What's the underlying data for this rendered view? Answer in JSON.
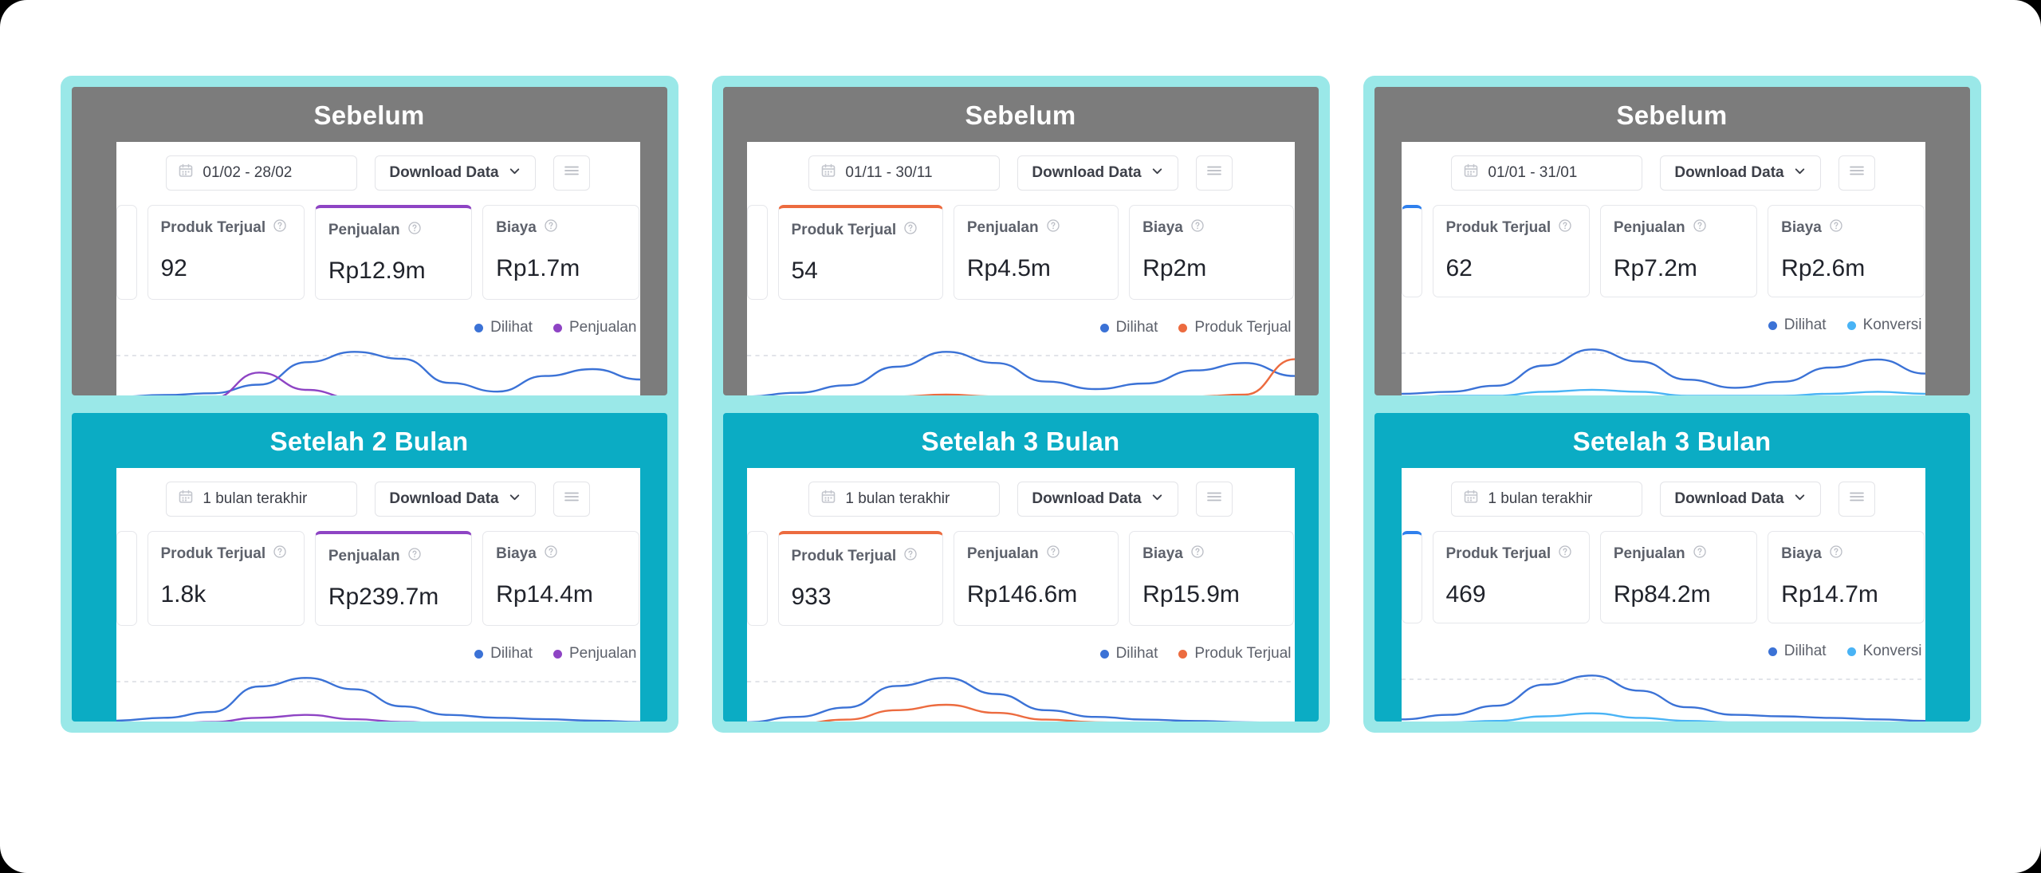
{
  "groups": [
    {
      "before": {
        "title": "Sebelum",
        "date_range": "01/02 - 28/02",
        "download_label": "Download Data",
        "metrics": [
          {
            "label": "Produk Terjual",
            "value": "92",
            "accent": "none"
          },
          {
            "label": "Penjualan",
            "value": "Rp12.9m",
            "accent": "#8e44c4"
          },
          {
            "label": "Biaya",
            "value": "Rp1.7m",
            "accent": "none"
          }
        ],
        "legend": [
          {
            "label": "Dilihat",
            "color": "#3b72d6"
          },
          {
            "label": "Penjualan",
            "color": "#8e44c4"
          }
        ]
      },
      "after": {
        "title": "Setelah 2 Bulan",
        "date_range": "1 bulan terakhir",
        "download_label": "Download Data",
        "metrics": [
          {
            "label": "Produk Terjual",
            "value": "1.8k",
            "accent": "none"
          },
          {
            "label": "Penjualan",
            "value": "Rp239.7m",
            "accent": "#8e44c4"
          },
          {
            "label": "Biaya",
            "value": "Rp14.4m",
            "accent": "none"
          }
        ],
        "legend": [
          {
            "label": "Dilihat",
            "color": "#3b72d6"
          },
          {
            "label": "Penjualan",
            "color": "#8e44c4"
          }
        ]
      }
    },
    {
      "before": {
        "title": "Sebelum",
        "date_range": "01/11 - 30/11",
        "download_label": "Download Data",
        "metrics": [
          {
            "label": "Produk Terjual",
            "value": "54",
            "accent": "#ec6b3f"
          },
          {
            "label": "Penjualan",
            "value": "Rp4.5m",
            "accent": "none"
          },
          {
            "label": "Biaya",
            "value": "Rp2m",
            "accent": "none"
          }
        ],
        "legend": [
          {
            "label": "Dilihat",
            "color": "#3b72d6"
          },
          {
            "label": "Produk Terjual",
            "color": "#ec6b3f"
          }
        ]
      },
      "after": {
        "title": "Setelah 3 Bulan",
        "date_range": "1 bulan terakhir",
        "download_label": "Download Data",
        "metrics": [
          {
            "label": "Produk Terjual",
            "value": "933",
            "accent": "#ec6b3f"
          },
          {
            "label": "Penjualan",
            "value": "Rp146.6m",
            "accent": "none"
          },
          {
            "label": "Biaya",
            "value": "Rp15.9m",
            "accent": "none"
          }
        ],
        "legend": [
          {
            "label": "Dilihat",
            "color": "#3b72d6"
          },
          {
            "label": "Produk Terjual",
            "color": "#ec6b3f"
          }
        ]
      }
    },
    {
      "before": {
        "title": "Sebelum",
        "date_range": "01/01 - 31/01",
        "download_label": "Download Data",
        "metrics": [
          {
            "label": "Produk Terjual",
            "value": "62",
            "accent": "none"
          },
          {
            "label": "Penjualan",
            "value": "Rp7.2m",
            "accent": "none"
          },
          {
            "label": "Biaya",
            "value": "Rp2.6m",
            "accent": "none"
          }
        ],
        "sliver_accent": "#2f80ed",
        "legend": [
          {
            "label": "Dilihat",
            "color": "#3b72d6"
          },
          {
            "label": "Konversi",
            "color": "#49b3f5"
          }
        ]
      },
      "after": {
        "title": "Setelah 3 Bulan",
        "date_range": "1 bulan terakhir",
        "download_label": "Download Data",
        "metrics": [
          {
            "label": "Produk Terjual",
            "value": "469",
            "accent": "none"
          },
          {
            "label": "Penjualan",
            "value": "Rp84.2m",
            "accent": "none"
          },
          {
            "label": "Biaya",
            "value": "Rp14.7m",
            "accent": "none"
          }
        ],
        "sliver_accent": "#2f80ed",
        "legend": [
          {
            "label": "Dilihat",
            "color": "#3b72d6"
          },
          {
            "label": "Konversi",
            "color": "#49b3f5"
          }
        ]
      }
    }
  ],
  "theme": {
    "frame_teal": "#9ae8e8",
    "before_gray": "#7c7c7c",
    "after_teal": "#0bacc4",
    "page_bg": "#ffffff"
  },
  "chart_data": [
    {
      "type": "line",
      "title": "Sebelum — Dilihat vs Penjualan",
      "x": [
        1,
        2,
        3,
        4,
        5,
        6,
        7,
        8,
        9,
        10,
        11,
        12
      ],
      "series": [
        {
          "name": "Dilihat",
          "color": "#3b72d6",
          "values": [
            2,
            3,
            4,
            9,
            22,
            28,
            24,
            10,
            5,
            14,
            18,
            12
          ]
        },
        {
          "name": "Penjualan",
          "color": "#8e44c4",
          "values": [
            0,
            0,
            1,
            16,
            6,
            1,
            0,
            0,
            0,
            1,
            2,
            1
          ]
        }
      ],
      "grid": true,
      "legend_position": "top-right"
    },
    {
      "type": "line",
      "title": "Setelah 2 Bulan — Dilihat vs Penjualan",
      "x": [
        1,
        2,
        3,
        4,
        5,
        6,
        7,
        8,
        9,
        10,
        11,
        12
      ],
      "series": [
        {
          "name": "Dilihat",
          "color": "#3b72d6",
          "values": [
            4,
            6,
            10,
            28,
            34,
            26,
            14,
            8,
            6,
            5,
            4,
            3
          ]
        },
        {
          "name": "Penjualan",
          "color": "#8e44c4",
          "values": [
            1,
            2,
            3,
            6,
            8,
            5,
            3,
            2,
            1,
            1,
            1,
            0
          ]
        }
      ],
      "grid": true,
      "legend_position": "top-right"
    },
    {
      "type": "line",
      "title": "Sebelum — Dilihat vs Produk Terjual",
      "x": [
        1,
        2,
        3,
        4,
        5,
        6,
        7,
        8,
        9,
        10,
        11,
        12
      ],
      "series": [
        {
          "name": "Dilihat",
          "color": "#3b72d6",
          "values": [
            2,
            4,
            8,
            18,
            26,
            20,
            10,
            6,
            9,
            16,
            20,
            13
          ]
        },
        {
          "name": "Produk Terjual",
          "color": "#ec6b3f",
          "values": [
            0,
            0,
            1,
            2,
            3,
            2,
            1,
            0,
            1,
            2,
            3,
            22
          ]
        }
      ],
      "grid": true,
      "legend_position": "top-right"
    },
    {
      "type": "line",
      "title": "Setelah 3 Bulan — Dilihat vs Produk Terjual",
      "x": [
        1,
        2,
        3,
        4,
        5,
        6,
        7,
        8,
        9,
        10,
        11,
        12
      ],
      "series": [
        {
          "name": "Dilihat",
          "color": "#3b72d6",
          "values": [
            3,
            7,
            14,
            30,
            36,
            24,
            12,
            7,
            5,
            4,
            3,
            2
          ]
        },
        {
          "name": "Produk Terjual",
          "color": "#ec6b3f",
          "values": [
            1,
            2,
            5,
            12,
            16,
            10,
            5,
            3,
            2,
            1,
            1,
            1
          ]
        }
      ],
      "grid": true,
      "legend_position": "top-right"
    },
    {
      "type": "line",
      "title": "Sebelum — Dilihat vs Konversi",
      "x": [
        1,
        2,
        3,
        4,
        5,
        6,
        7,
        8,
        9,
        10,
        11,
        12
      ],
      "series": [
        {
          "name": "Dilihat",
          "color": "#3b72d6",
          "values": [
            2,
            3,
            6,
            16,
            24,
            18,
            9,
            5,
            8,
            15,
            19,
            12
          ]
        },
        {
          "name": "Konversi",
          "color": "#49b3f5",
          "values": [
            0,
            1,
            1,
            3,
            4,
            3,
            1,
            1,
            1,
            2,
            3,
            2
          ]
        }
      ],
      "grid": true,
      "legend_position": "top-right"
    },
    {
      "type": "line",
      "title": "Setelah 3 Bulan — Dilihat vs Konversi",
      "x": [
        1,
        2,
        3,
        4,
        5,
        6,
        7,
        8,
        9,
        10,
        11,
        12
      ],
      "series": [
        {
          "name": "Dilihat",
          "color": "#3b72d6",
          "values": [
            3,
            6,
            12,
            26,
            32,
            22,
            11,
            6,
            5,
            4,
            3,
            2
          ]
        },
        {
          "name": "Konversi",
          "color": "#49b3f5",
          "values": [
            0,
            1,
            2,
            5,
            7,
            4,
            2,
            1,
            1,
            1,
            1,
            0
          ]
        }
      ],
      "grid": true,
      "legend_position": "top-right"
    }
  ]
}
